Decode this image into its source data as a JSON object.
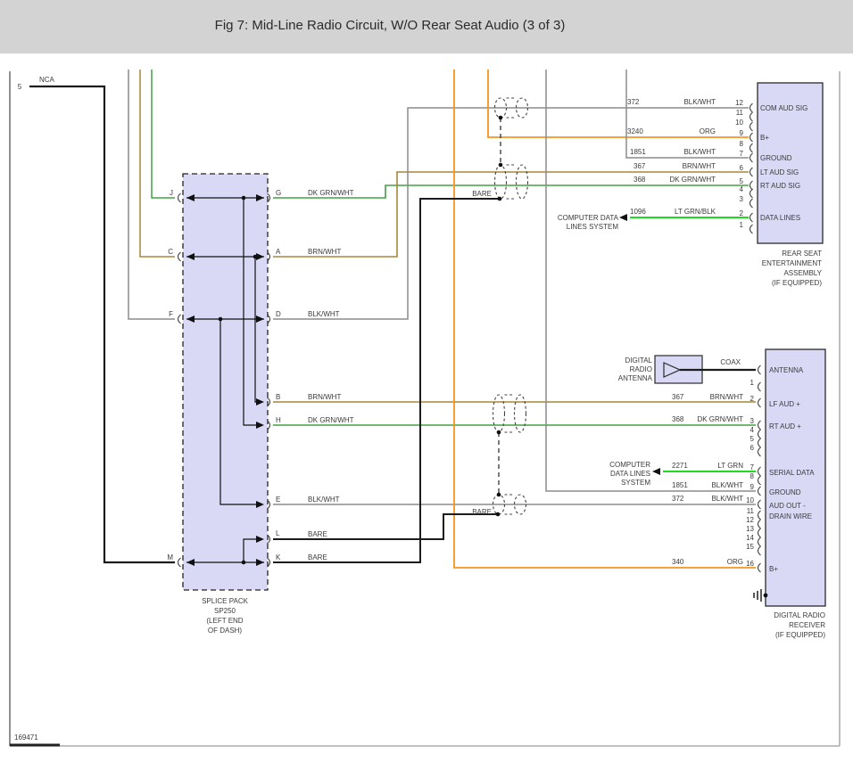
{
  "title": "Fig 7: Mid-Line Radio Circuit, W/O Rear Seat Audio (3 of 3)",
  "drawing_number": "169471",
  "left_margin": {
    "grid_ref": "5",
    "wire_label": "NCA"
  },
  "splice_pack": {
    "title_lines": [
      "SPLICE PACK",
      "SP250",
      "(LEFT END",
      "OF DASH)"
    ],
    "pins": {
      "J": "J",
      "C": "C",
      "F": "F",
      "M": "M",
      "G": "G",
      "A": "A",
      "D": "D",
      "B": "B",
      "H": "H",
      "E": "E",
      "L": "L",
      "K": "K"
    },
    "wires": {
      "G": "DK GRN/WHT",
      "A": "BRN/WHT",
      "D": "BLK/WHT",
      "B": "BRN/WHT",
      "H": "DK GRN/WHT",
      "E": "BLK/WHT",
      "L": "BARE",
      "K": "BARE"
    }
  },
  "shields": {
    "upper_bare_label": "BARE",
    "lower_bare_label": "BARE"
  },
  "computer_data_top": {
    "line1": "COMPUTER DATA",
    "line2": "LINES SYSTEM"
  },
  "computer_data_bottom": {
    "line1": "COMPUTER",
    "line2": "DATA LINES",
    "line3": "SYSTEM"
  },
  "antenna": {
    "line1": "DIGITAL",
    "line2": "RADIO",
    "line3": "ANTENNA",
    "wire": "COAX"
  },
  "rear_seat": {
    "label_lines": [
      "REAR SEAT",
      "ENTERTAINMENT",
      "ASSEMBLY",
      "(IF EQUIPPED)"
    ],
    "rows": [
      {
        "num": "12",
        "circuit": "372",
        "color": "BLK/WHT",
        "label": "COM AUD SIG"
      },
      {
        "num": "11"
      },
      {
        "num": "10"
      },
      {
        "num": "9",
        "circuit": "3240",
        "color": "ORG",
        "label": "B+"
      },
      {
        "num": "8"
      },
      {
        "num": "7",
        "circuit": "1851",
        "color": "BLK/WHT",
        "label": "GROUND"
      },
      {
        "num": "6",
        "circuit": "367",
        "color": "BRN/WHT",
        "label": "LT AUD SIG"
      },
      {
        "num": "5",
        "circuit": "368",
        "color": "DK GRN/WHT",
        "label": "RT AUD SIG"
      },
      {
        "num": "4"
      },
      {
        "num": "3"
      },
      {
        "num": "2",
        "circuit": "1096",
        "color": "LT GRN/BLK",
        "label": "DATA LINES"
      },
      {
        "num": "1"
      }
    ]
  },
  "receiver": {
    "label_lines": [
      "DIGITAL RADIO",
      "RECEIVER",
      "(IF EQUIPPED)"
    ],
    "antenna_label": "ANTENNA",
    "rows": [
      {
        "num": "1"
      },
      {
        "num": "2",
        "circuit": "367",
        "color": "BRN/WHT",
        "label": "LF AUD +"
      },
      {
        "num": "3",
        "circuit": "368",
        "color": "DK GRN/WHT",
        "label": "RT AUD +"
      },
      {
        "num": "4"
      },
      {
        "num": "5"
      },
      {
        "num": "6"
      },
      {
        "num": "7",
        "circuit": "2271",
        "color": "LT GRN",
        "label": "SERIAL DATA"
      },
      {
        "num": "8"
      },
      {
        "num": "9",
        "circuit": "1851",
        "color": "BLK/WHT",
        "label": "GROUND"
      },
      {
        "num": "10",
        "circuit": "372",
        "color": "BLK/WHT",
        "label": "AUD OUT -"
      },
      {
        "num": "11",
        "label": "DRAIN WIRE"
      },
      {
        "num": "12"
      },
      {
        "num": "13"
      },
      {
        "num": "14"
      },
      {
        "num": "15"
      },
      {
        "num": "16",
        "circuit": "340",
        "color": "ORG",
        "label": "B+"
      }
    ]
  },
  "colors": {
    "blk_wht": "#8c8c8c",
    "brn_wht": "#a8863c",
    "dk_grn_wht": "#42a042",
    "lt_grn": "#00d400",
    "org": "#f7941e",
    "bare": "#1c1c1c",
    "box_fill": "#d9d9f6",
    "title_bg": "#d3d3d3"
  }
}
